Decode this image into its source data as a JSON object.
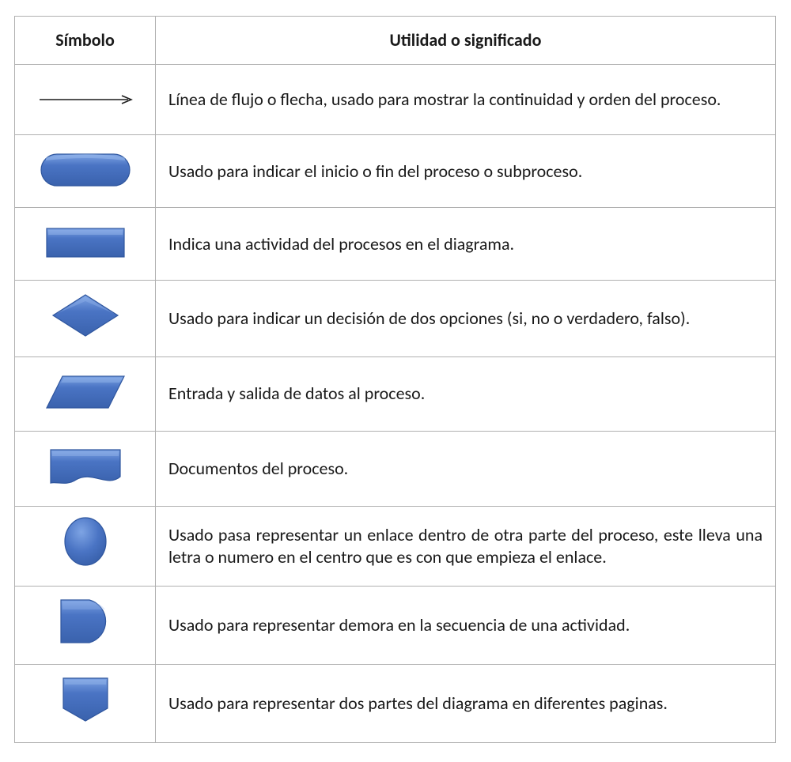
{
  "table": {
    "headers": {
      "symbol": "Símbolo",
      "meaning": "Utilidad o significado"
    },
    "rows": [
      {
        "icon": "flowline-arrow-icon",
        "description": "Línea de flujo o flecha, usado para mostrar la continuidad y orden del proceso.",
        "justify": false
      },
      {
        "icon": "terminator-icon",
        "description": "Usado para indicar el inicio o fin del proceso o subproceso.",
        "justify": false
      },
      {
        "icon": "process-rectangle-icon",
        "description": "Indica una actividad del  procesos en el diagrama.",
        "justify": false
      },
      {
        "icon": "decision-diamond-icon",
        "description": "Usado para indicar un decisión de dos opciones (si, no o verdadero, falso).",
        "justify": true
      },
      {
        "icon": "data-parallelogram-icon",
        "description": "Entrada  y salida de datos al proceso.",
        "justify": false
      },
      {
        "icon": "document-icon",
        "description": "Documentos  del proceso.",
        "justify": false
      },
      {
        "icon": "connector-circle-icon",
        "description": "Usado pasa representar un enlace dentro de otra parte del proceso, este lleva una letra o numero en el centro que es con que empieza el enlace.",
        "justify": true
      },
      {
        "icon": "delay-icon",
        "description": "Usado para representar demora en la secuencia de una actividad.",
        "justify": false
      },
      {
        "icon": "offpage-connector-icon",
        "description": "Usado para representar dos partes del diagrama en diferentes paginas.",
        "justify": true
      }
    ]
  },
  "colors": {
    "shapeFill": "#4a74c4",
    "shapeHighlight": "#7ea4e4",
    "shapeStroke": "#2f569e"
  }
}
